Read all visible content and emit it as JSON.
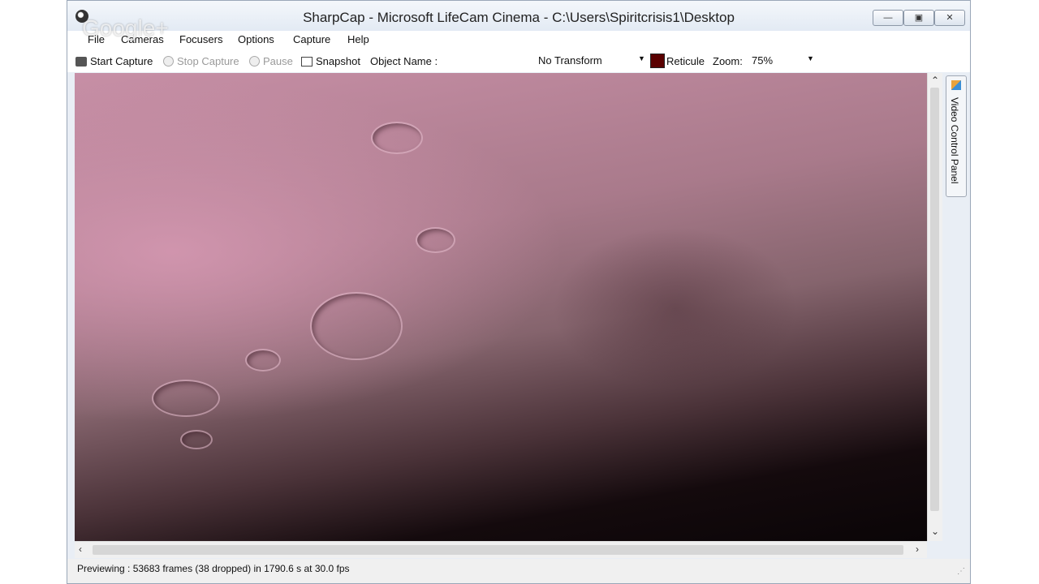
{
  "window": {
    "title": "SharpCap - Microsoft LifeCam Cinema - C:\\Users\\Spiritcrisis1\\Desktop",
    "minimize_glyph": "—",
    "restore_glyph": "▣",
    "close_glyph": "✕"
  },
  "watermark": "Google+",
  "menu": {
    "items": [
      "File",
      "Cameras",
      "Focusers",
      "Options",
      "Capture",
      "Help"
    ]
  },
  "toolbar": {
    "start_capture": "Start Capture",
    "stop_capture": "Stop Capture",
    "pause": "Pause",
    "snapshot": "Snapshot",
    "object_name_label": "Object Name :",
    "transform_value": "No Transform",
    "reticule": "Reticule",
    "zoom_label": "Zoom:",
    "zoom_value": "75%"
  },
  "side_panel": {
    "label": "Video Control Panel"
  },
  "status": {
    "text": "Previewing : 53683 frames (38 dropped) in 1790.6 s at 30.0 fps"
  },
  "colors": {
    "accent": "#5a0000",
    "window_frame": "#9aa7b8"
  }
}
